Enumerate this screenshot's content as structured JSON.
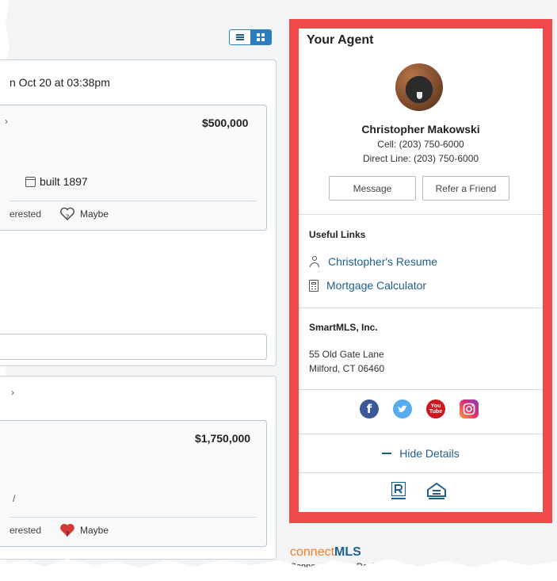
{
  "view_toggle": {
    "list_icon": "list-view-icon",
    "grid_icon": "grid-view-icon",
    "active": "grid"
  },
  "listings": {
    "card1": {
      "timestamp": "n Oct 20 at 03:38pm",
      "price": "$500,000",
      "built": "built 1897",
      "interested_fragment": "erested",
      "maybe_label": "Maybe",
      "maybe_state": "unselected"
    },
    "card2": {
      "price": "$1,750,000",
      "interested_fragment": "erested",
      "maybe_label": "Maybe",
      "maybe_state": "selected"
    }
  },
  "agent": {
    "heading": "Your Agent",
    "name": "Christopher Makowski",
    "cell": "Cell: (203) 750-6000",
    "direct": "Direct Line: (203) 750-6000",
    "message_button": "Message",
    "refer_button": "Refer a Friend",
    "useful_links_title": "Useful Links",
    "links": [
      {
        "label": "Christopher's Resume",
        "icon": "person-icon"
      },
      {
        "label": "Mortgage Calculator",
        "icon": "calculator-icon"
      }
    ],
    "office": {
      "name": "SmartMLS, Inc.",
      "address_line1": "55 Old Gate Lane",
      "address_line2": "Milford, CT 06460"
    },
    "social": [
      {
        "name": "facebook-icon",
        "color": "#3b5998",
        "glyph": "f"
      },
      {
        "name": "twitter-icon",
        "color": "#55acee",
        "glyph": "t"
      },
      {
        "name": "youtube-icon",
        "color": "#cc181e",
        "glyph": "You Tube"
      },
      {
        "name": "instagram-icon",
        "color": "#c13584",
        "glyph": ""
      }
    ],
    "hide_details": "Hide Details",
    "highlight_color": "#f04a4a"
  },
  "footer": {
    "brand_connect": "connect",
    "brand_mls": "MLS",
    "tagline": "Connecting Your Real E"
  }
}
